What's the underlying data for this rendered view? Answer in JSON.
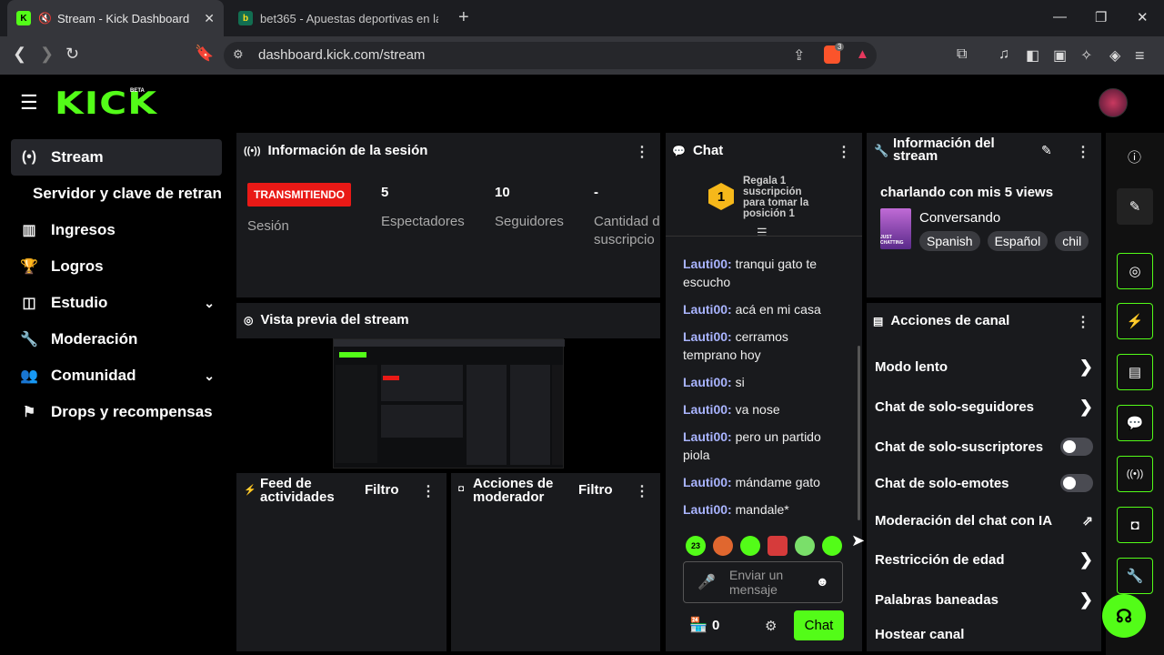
{
  "browser": {
    "tabs": [
      {
        "title": "Stream - Kick Dashboard",
        "fav": "K"
      },
      {
        "title": "bet365 - Apuestas deportivas en la re",
        "fav": "b"
      }
    ],
    "url": "dashboard.kick.com/stream",
    "brave_count": "3"
  },
  "header": {
    "logo": "KICK",
    "beta": "BETA"
  },
  "sidebar": {
    "items": [
      {
        "label": "Stream",
        "icon": "broadcast-icon"
      },
      {
        "label": "Servidor y clave de retransm"
      },
      {
        "label": "Ingresos",
        "icon": "chart-icon"
      },
      {
        "label": "Logros",
        "icon": "trophy-icon"
      },
      {
        "label": "Estudio",
        "icon": "studio-icon"
      },
      {
        "label": "Moderación",
        "icon": "wrench-icon"
      },
      {
        "label": "Comunidad",
        "icon": "community-icon"
      },
      {
        "label": "Drops y recompensas",
        "icon": "drops-icon"
      }
    ]
  },
  "session": {
    "title": "Información de la sesión",
    "status": "TRANSMITIENDO",
    "status_label": "Sesión",
    "viewers": "5",
    "viewers_label": "Espectadores",
    "followers": "10",
    "followers_label": "Seguidores",
    "subs": "-",
    "subs_label": "Cantidad d",
    "subs_label2": "suscripcio"
  },
  "preview": {
    "title": "Vista previa del stream"
  },
  "feed": {
    "title1": "Feed de",
    "title2": "actividades",
    "filter": "Filtro"
  },
  "modactions": {
    "title1": "Acciones de",
    "title2": "moderador",
    "filter": "Filtro"
  },
  "chat": {
    "title": "Chat",
    "promo1": "Regala 1",
    "promo2": "suscripción",
    "promo3": "para tomar la",
    "promo4": "posición 1",
    "rank": "1",
    "messages": [
      {
        "user": "Lauti00:",
        "text": "tranqui gato te",
        "text2": "escucho"
      },
      {
        "user": "Lauti00:",
        "text": "acá en mi casa"
      },
      {
        "user": "Lauti00:",
        "text": "cerramos",
        "text2": "temprano hoy"
      },
      {
        "user": "Lauti00:",
        "text": "si"
      },
      {
        "user": "Lauti00:",
        "text": "va nose"
      },
      {
        "user": "Lauti00:",
        "text": "pero un partido",
        "text2": "piola"
      },
      {
        "user": "Lauti00:",
        "text": "mándame gato"
      },
      {
        "user": "Lauti00:",
        "text": "mandale*"
      }
    ],
    "input_placeholder1": "Enviar un",
    "input_placeholder2": "mensaje",
    "points": "0",
    "send": "Chat"
  },
  "streaminfo": {
    "title1": "Información del",
    "title2": "stream",
    "stream_title": "charlando con mis 5 views",
    "category": "Conversando",
    "thumb_text": "JUST CHATTING",
    "tags": [
      "Spanish",
      "Español",
      "chil"
    ]
  },
  "channel_actions": {
    "title": "Acciones de canal",
    "items": [
      {
        "label": "Modo lento",
        "kind": "arrow"
      },
      {
        "label": "Chat de solo-seguidores",
        "kind": "arrow"
      },
      {
        "label": "Chat de solo-suscriptores",
        "kind": "toggle",
        "on": false
      },
      {
        "label": "Chat de solo-emotes",
        "kind": "toggle",
        "on": false
      },
      {
        "label": "Moderación del chat con IA",
        "kind": "external"
      },
      {
        "label": "Restricción de edad",
        "kind": "arrow"
      },
      {
        "label": "Palabras baneadas",
        "kind": "arrow"
      },
      {
        "label": "Hostear canal",
        "kind": "none"
      }
    ]
  },
  "colors": {
    "accent": "#53fc18",
    "live": "#e91916",
    "username": "#a9b4ff"
  }
}
